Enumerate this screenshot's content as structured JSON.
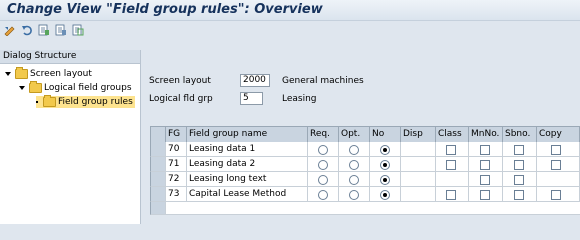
{
  "title": "Change View \"Field group rules\": Overview",
  "toolbar": [
    "display-change-icon",
    "undo-icon",
    "select-all-icon",
    "deselect-all-icon",
    "select-block-icon"
  ],
  "dialog_structure": {
    "header": "Dialog Structure",
    "items": [
      {
        "label": "Screen layout",
        "level": 0
      },
      {
        "label": "Logical field groups",
        "level": 1
      },
      {
        "label": "Field group rules",
        "level": 2,
        "selected": true
      }
    ]
  },
  "fields": {
    "screen_layout": {
      "label": "Screen layout",
      "value": "2000",
      "desc": "General machines"
    },
    "logical_fld_grp": {
      "label": "Logical fld grp",
      "value": "5",
      "desc": "Leasing"
    }
  },
  "table": {
    "columns": [
      "FG",
      "Field group name",
      "Req.",
      "Opt.",
      "No",
      "Disp",
      "Class",
      "MnNo.",
      "Sbno.",
      "Copy"
    ],
    "rows": [
      {
        "fg": "70",
        "name": "Leasing data 1",
        "choice": "No",
        "class": true,
        "mnno": true,
        "sbno": true,
        "copy": true
      },
      {
        "fg": "71",
        "name": "Leasing data 2",
        "choice": "No",
        "class": true,
        "mnno": true,
        "sbno": true,
        "copy": true
      },
      {
        "fg": "72",
        "name": "Leasing long text",
        "choice": "No",
        "class": false,
        "mnno": true,
        "sbno": true,
        "copy": false
      },
      {
        "fg": "73",
        "name": "Capital Lease Method",
        "choice": "No",
        "class": true,
        "mnno": true,
        "sbno": true,
        "copy": true
      }
    ]
  }
}
